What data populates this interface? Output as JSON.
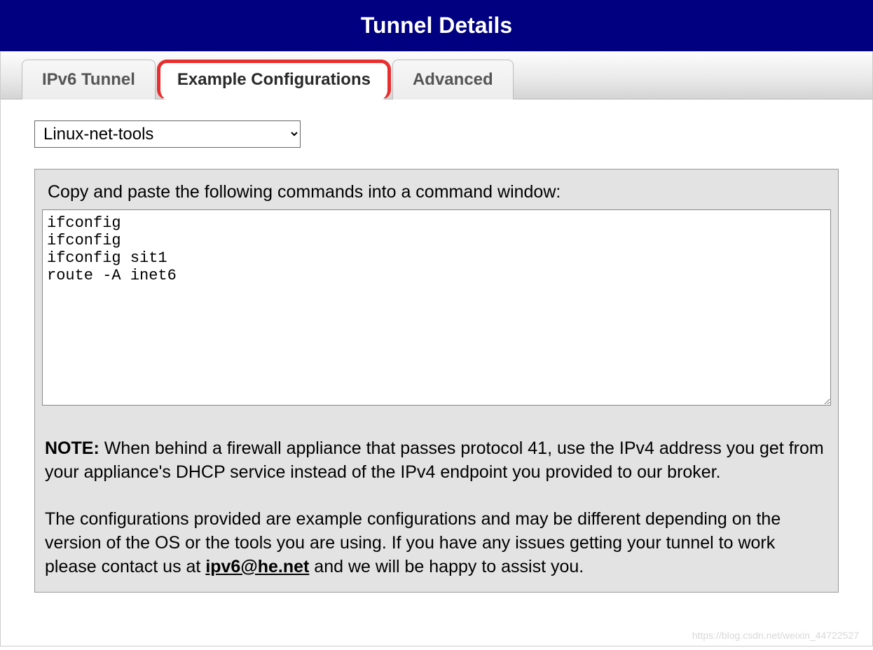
{
  "header": {
    "title": "Tunnel Details"
  },
  "tabs": {
    "ipv6": {
      "label": "IPv6 Tunnel"
    },
    "example": {
      "label": "Example Configurations"
    },
    "advanced": {
      "label": "Advanced"
    }
  },
  "select": {
    "value": "Linux-net-tools"
  },
  "config": {
    "instruction": "Copy and paste the following commands into a command window:",
    "commands": "ifconfig\nifconfig \nifconfig sit1 \nroute -A inet6"
  },
  "note": {
    "label": "NOTE:",
    "body1": " When behind a firewall appliance that passes protocol 41, use the IPv4 address you get from your appliance's DHCP service instead of the IPv4 endpoint you provided to our broker.",
    "body2a": "The configurations provided are example configurations and may be different depending on the version of the OS or the tools you are using. If you have any issues getting your tunnel to work please contact us at ",
    "email": "ipv6@he.net",
    "body2b": " and we will be happy to assist you."
  },
  "watermark": "https://blog.csdn.net/weixin_44722527"
}
